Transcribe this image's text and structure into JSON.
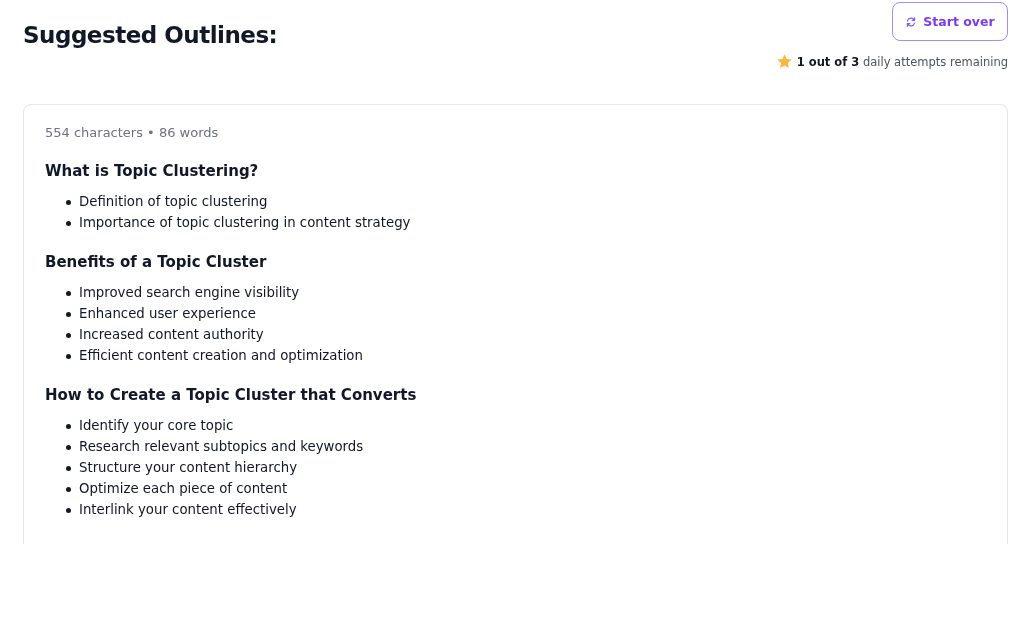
{
  "title": "Suggested Outlines:",
  "start_over_button": "Start over",
  "attempts": "**1 out of 3** daily attempts remaining",
  "stats": "554 characters • 86 words",
  "sections": [
    {
      "heading": "What is Topic Clustering?",
      "items": [
        "Definition of topic clustering",
        "Importance of topic clustering in content strategy"
      ]
    },
    {
      "heading": "Benefits of a Topic Cluster",
      "items": [
        "Improved search engine visibility",
        "Enhanced user experience",
        "Increased content authority",
        "Efficient content creation and optimization"
      ]
    },
    {
      "heading": "How to Create a Topic Cluster that Converts",
      "items": [
        "Identify your core topic",
        "Research relevant subtopics and keywords",
        "Structure your content hierarchy",
        "Optimize each piece of content",
        "Interlink your content effectively"
      ]
    }
  ]
}
